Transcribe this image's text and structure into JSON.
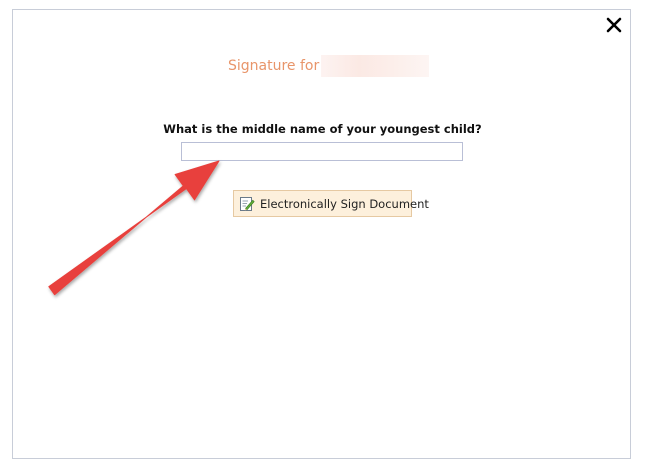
{
  "dialog": {
    "title": "Signature for",
    "question": "What is the middle name of your youngest child?",
    "answer_value": "",
    "sign_button_label": "Electronically Sign Document",
    "close_icon": "close-icon",
    "sign_icon": "document-sign-icon"
  },
  "colors": {
    "title": "#e8956a",
    "button_bg": "#fdf0dc",
    "button_border": "#e6c9a2",
    "input_border": "#b9bfd6",
    "arrow": "#e8403c"
  }
}
